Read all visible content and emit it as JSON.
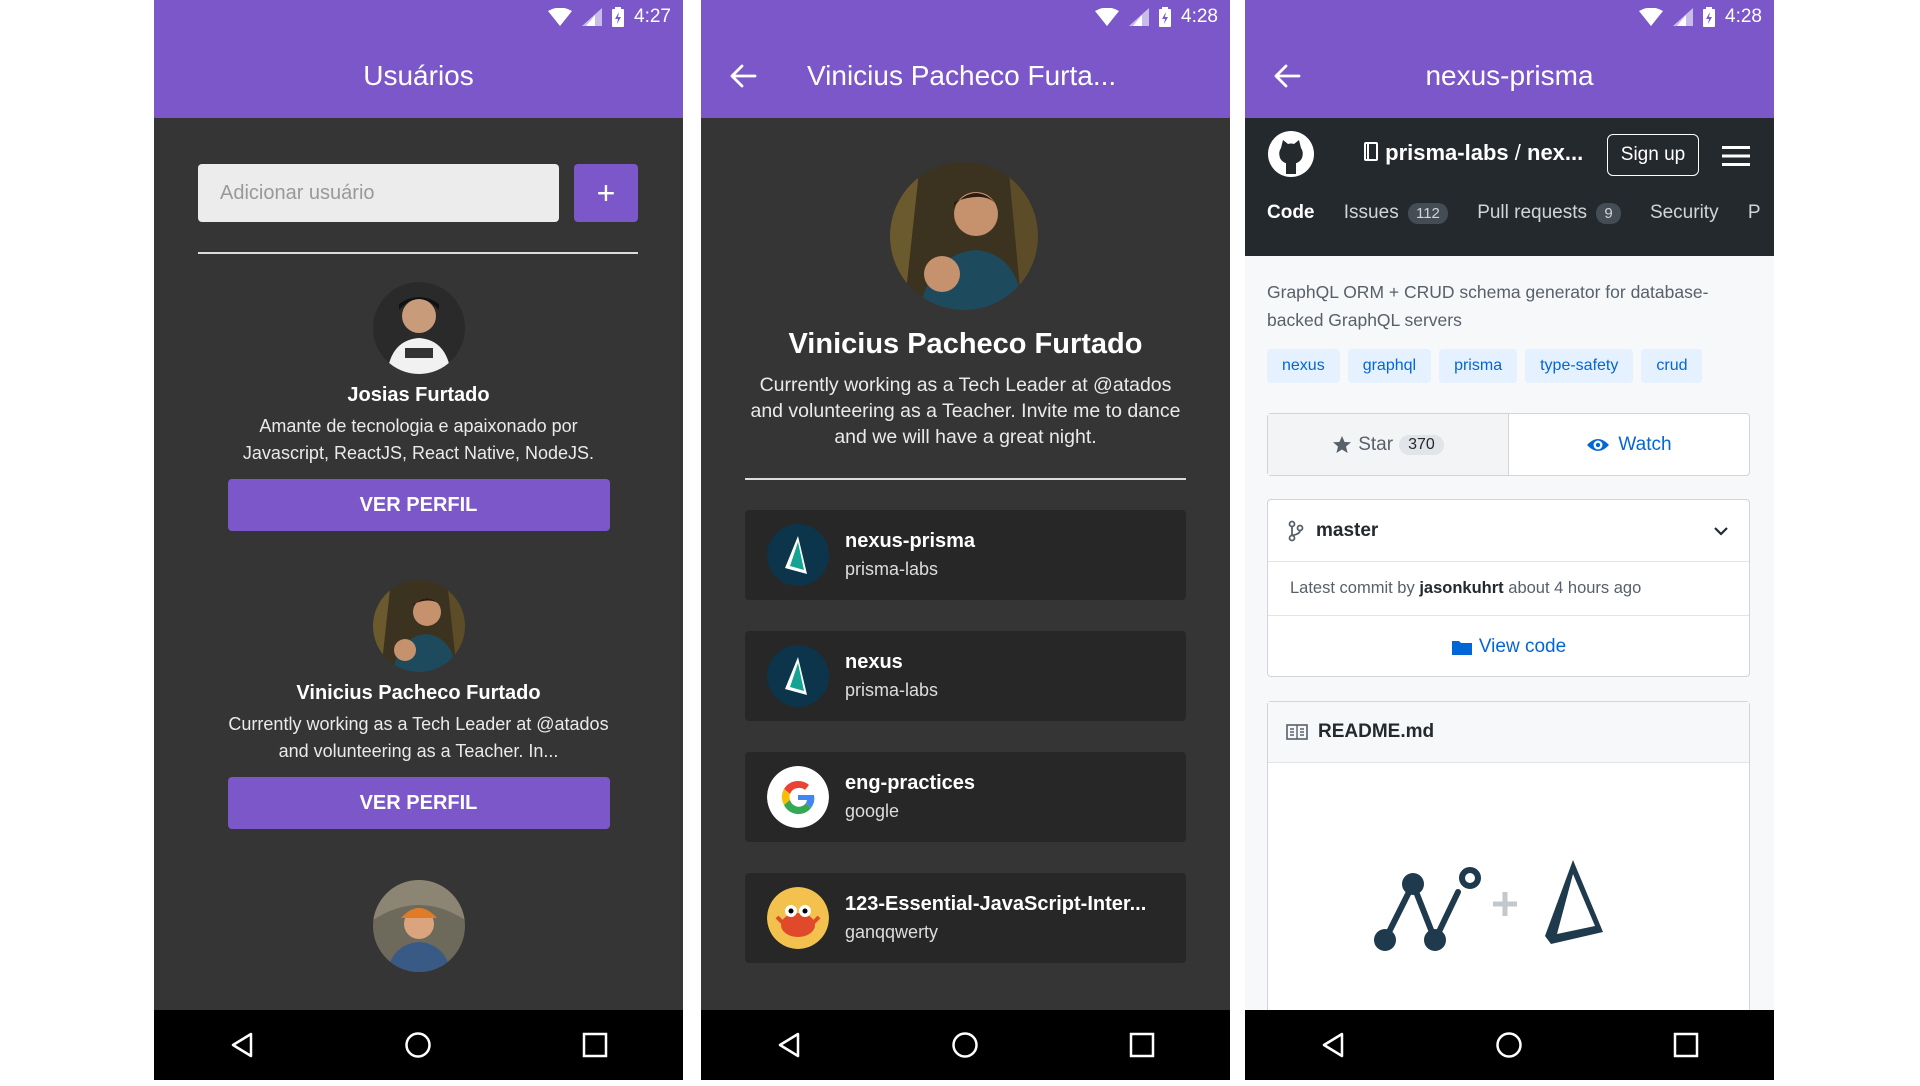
{
  "status": {
    "screen1_time": "4:27",
    "screen2_time": "4:28",
    "screen3_time": "4:28"
  },
  "colors": {
    "primary": "#7b57c9",
    "dark_bg": "#353535",
    "card_bg": "#272727",
    "github_header": "#24292e",
    "link_blue": "#0366d6"
  },
  "screen1": {
    "title": "Usuários",
    "add_placeholder": "Adicionar usuário",
    "add_button": "+",
    "users": [
      {
        "name": "Josias Furtado",
        "bio": "Amante de tecnologia e apaixonado por Javascript, ReactJS, React Native, NodeJS.",
        "button": "VER PERFIL"
      },
      {
        "name": "Vinicius Pacheco Furtado",
        "bio": "Currently working as a Tech Leader at @atados and volunteering as a Teacher. In...",
        "button": "VER PERFIL"
      }
    ]
  },
  "screen2": {
    "title": "Vinicius Pacheco Furta...",
    "name": "Vinicius Pacheco Furtado",
    "bio": "Currently working as a Tech Leader at @atados and volunteering as a Teacher. Invite me to dance and we will have a great night.",
    "repos": [
      {
        "name": "nexus-prisma",
        "owner": "prisma-labs",
        "icon": "prisma-icon"
      },
      {
        "name": "nexus",
        "owner": "prisma-labs",
        "icon": "prisma-icon"
      },
      {
        "name": "eng-practices",
        "owner": "google",
        "icon": "google-icon"
      },
      {
        "name": "123-Essential-JavaScript-Inter...",
        "owner": "ganqqwerty",
        "icon": "crab-icon"
      }
    ]
  },
  "screen3": {
    "title": "nexus-prisma",
    "repo_owner": "prisma-labs",
    "repo_sep": "/",
    "repo_name": "nex...",
    "signup": "Sign up",
    "tabs": [
      {
        "label": "Code",
        "count": ""
      },
      {
        "label": "Issues",
        "count": "112"
      },
      {
        "label": "Pull requests",
        "count": "9"
      },
      {
        "label": "Security",
        "count": ""
      },
      {
        "label": "P",
        "count": ""
      }
    ],
    "description": "GraphQL ORM + CRUD schema generator for database-backed GraphQL servers",
    "topics": [
      "nexus",
      "graphql",
      "prisma",
      "type-safety",
      "crud"
    ],
    "star_label": "Star",
    "star_count": "370",
    "watch_label": "Watch",
    "branch": "master",
    "commit_prefix": "Latest commit by",
    "commit_author": "jasonkuhrt",
    "commit_time": "about 4 hours ago",
    "view_code": "View code",
    "readme": "README.md"
  }
}
